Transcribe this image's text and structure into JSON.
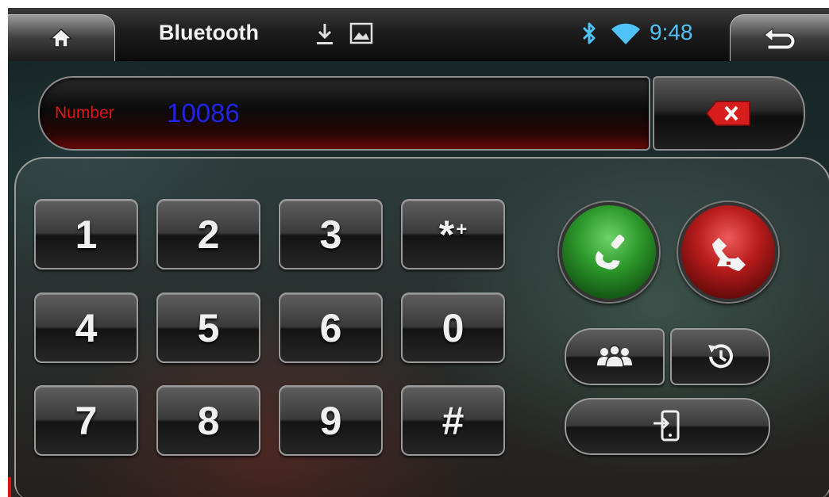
{
  "status_bar": {
    "title": "Bluetooth",
    "time": "9:48",
    "icons": [
      "home-icon",
      "download-icon",
      "image-icon",
      "bluetooth-icon",
      "wifi-icon",
      "back-icon"
    ]
  },
  "dialer": {
    "number_label": "Number",
    "number_value": "10086"
  },
  "keypad": {
    "keys": [
      {
        "label": "1"
      },
      {
        "label": "2"
      },
      {
        "label": "3"
      },
      {
        "label": "*",
        "sup": "+"
      },
      {
        "label": "4"
      },
      {
        "label": "5"
      },
      {
        "label": "6"
      },
      {
        "label": "0"
      },
      {
        "label": "7"
      },
      {
        "label": "8"
      },
      {
        "label": "9"
      },
      {
        "label": "#"
      }
    ]
  },
  "actions": {
    "icons": [
      "backspace-icon",
      "phone-answer-icon",
      "phone-hangup-icon",
      "contacts-icon",
      "call-history-icon",
      "phone-transfer-icon"
    ]
  },
  "colors": {
    "accent_blue": "#4fc3f7",
    "number_label": "#e01414",
    "number_value": "#1f24e6",
    "call_green": "#2e9a2c",
    "hangup_red": "#b81c1c"
  }
}
